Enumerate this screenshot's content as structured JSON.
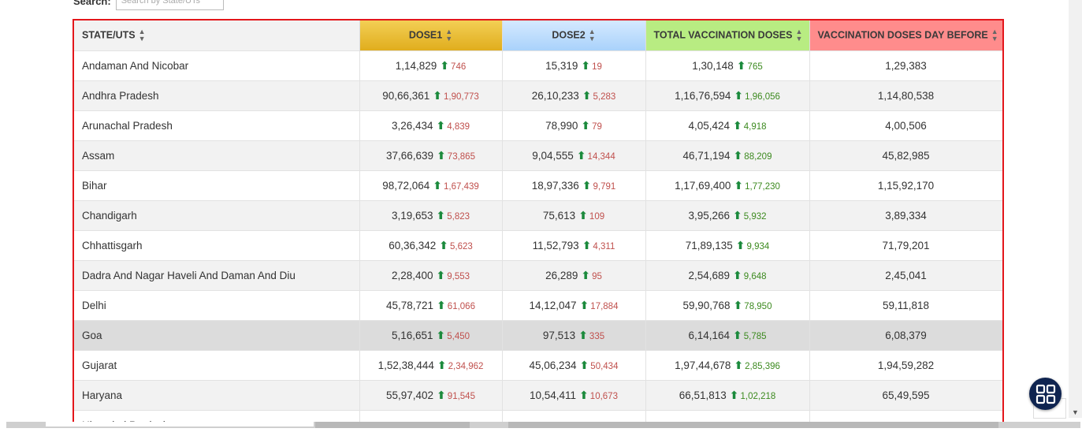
{
  "search": {
    "label": "Search:",
    "placeholder": "Search by State/UTs"
  },
  "table": {
    "headers": [
      "STATE/UTS",
      "DOSE1",
      "DOSE2",
      "TOTAL VACCINATION DOSES",
      "VACCINATION DOSES DAY BEFORE"
    ],
    "rows": [
      {
        "state": "Andaman And Nicobar",
        "dose1": "1,14,829",
        "dose1_delta": "746",
        "dose2": "15,319",
        "dose2_delta": "19",
        "total": "1,30,148",
        "total_delta": "765",
        "before": "1,29,383"
      },
      {
        "state": "Andhra Pradesh",
        "dose1": "90,66,361",
        "dose1_delta": "1,90,773",
        "dose2": "26,10,233",
        "dose2_delta": "5,283",
        "total": "1,16,76,594",
        "total_delta": "1,96,056",
        "before": "1,14,80,538"
      },
      {
        "state": "Arunachal Pradesh",
        "dose1": "3,26,434",
        "dose1_delta": "4,839",
        "dose2": "78,990",
        "dose2_delta": "79",
        "total": "4,05,424",
        "total_delta": "4,918",
        "before": "4,00,506"
      },
      {
        "state": "Assam",
        "dose1": "37,66,639",
        "dose1_delta": "73,865",
        "dose2": "9,04,555",
        "dose2_delta": "14,344",
        "total": "46,71,194",
        "total_delta": "88,209",
        "before": "45,82,985"
      },
      {
        "state": "Bihar",
        "dose1": "98,72,064",
        "dose1_delta": "1,67,439",
        "dose2": "18,97,336",
        "dose2_delta": "9,791",
        "total": "1,17,69,400",
        "total_delta": "1,77,230",
        "before": "1,15,92,170"
      },
      {
        "state": "Chandigarh",
        "dose1": "3,19,653",
        "dose1_delta": "5,823",
        "dose2": "75,613",
        "dose2_delta": "109",
        "total": "3,95,266",
        "total_delta": "5,932",
        "before": "3,89,334"
      },
      {
        "state": "Chhattisgarh",
        "dose1": "60,36,342",
        "dose1_delta": "5,623",
        "dose2": "11,52,793",
        "dose2_delta": "4,311",
        "total": "71,89,135",
        "total_delta": "9,934",
        "before": "71,79,201"
      },
      {
        "state": "Dadra And Nagar Haveli And Daman And Diu",
        "dose1": "2,28,400",
        "dose1_delta": "9,553",
        "dose2": "26,289",
        "dose2_delta": "95",
        "total": "2,54,689",
        "total_delta": "9,648",
        "before": "2,45,041"
      },
      {
        "state": "Delhi",
        "dose1": "45,78,721",
        "dose1_delta": "61,066",
        "dose2": "14,12,047",
        "dose2_delta": "17,884",
        "total": "59,90,768",
        "total_delta": "78,950",
        "before": "59,11,818"
      },
      {
        "state": "Goa",
        "dose1": "5,16,651",
        "dose1_delta": "5,450",
        "dose2": "97,513",
        "dose2_delta": "335",
        "total": "6,14,164",
        "total_delta": "5,785",
        "before": "6,08,379"
      },
      {
        "state": "Gujarat",
        "dose1": "1,52,38,444",
        "dose1_delta": "2,34,962",
        "dose2": "45,06,234",
        "dose2_delta": "50,434",
        "total": "1,97,44,678",
        "total_delta": "2,85,396",
        "before": "1,94,59,282"
      },
      {
        "state": "Haryana",
        "dose1": "55,97,402",
        "dose1_delta": "91,545",
        "dose2": "10,54,411",
        "dose2_delta": "10,673",
        "total": "66,51,813",
        "total_delta": "1,02,218",
        "before": "65,49,595"
      }
    ],
    "partial_row_state": "Himachal Pradesh"
  },
  "colors": {
    "table_border": "#e3161b",
    "dose1_header": "#e8bb35",
    "dose2_header": "#bcdcfc",
    "total_header": "#b8ec82",
    "before_header": "#ff8c8c",
    "arrow_up": "#1b8a3c",
    "delta_dose": "#c0504d",
    "delta_total": "#3c8a1f",
    "fab": "#0f2450"
  },
  "icons": {
    "sort": "sort-icon",
    "arrow": "up-arrow-icon",
    "fab": "grid-apps-icon"
  }
}
